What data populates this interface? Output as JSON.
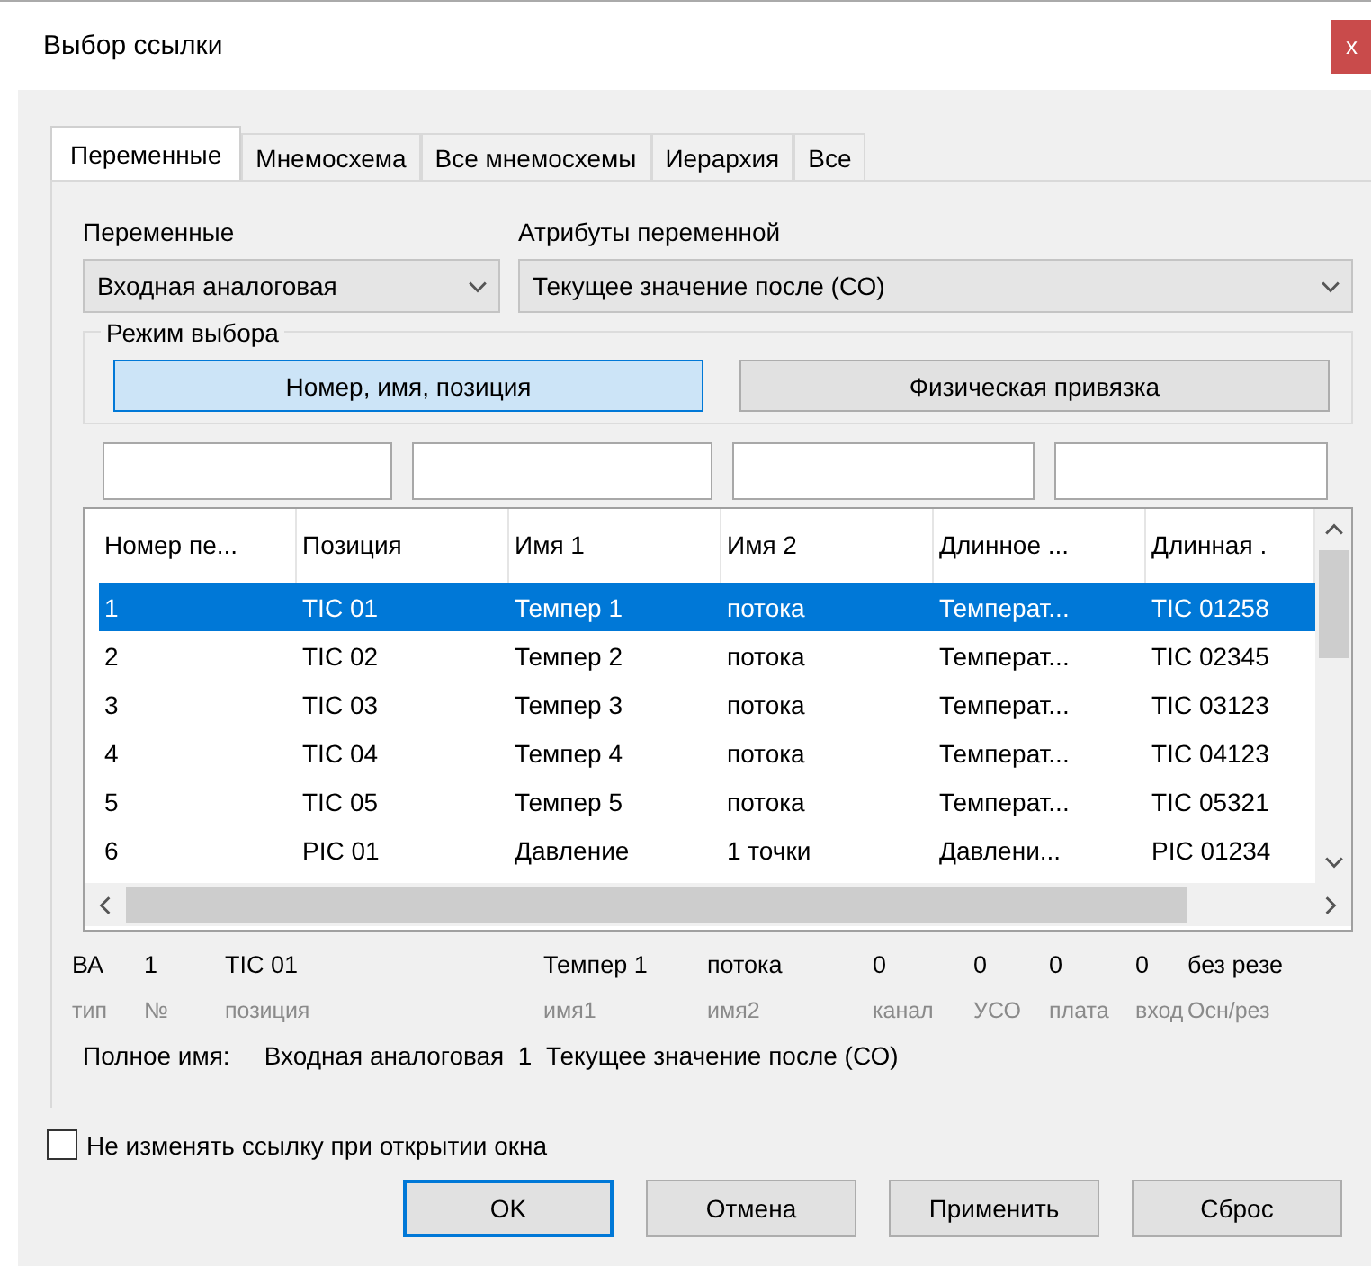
{
  "window": {
    "title": "Выбор ссылки",
    "close": "x"
  },
  "tabs": [
    {
      "label": "Переменные",
      "selected": true
    },
    {
      "label": "Мнемосхема",
      "selected": false
    },
    {
      "label": "Все мнемосхемы",
      "selected": false
    },
    {
      "label": "Иерархия",
      "selected": false
    },
    {
      "label": "Все",
      "selected": false
    }
  ],
  "variables": {
    "label": "Переменные",
    "value": "Входная аналоговая"
  },
  "attributes": {
    "label": "Атрибуты переменной",
    "value": "Текущее значение после (СО)"
  },
  "selection_mode": {
    "title": "Режим выбора",
    "buttons": [
      {
        "label": "Номер, имя, позиция",
        "selected": true
      },
      {
        "label": "Физическая привязка",
        "selected": false
      }
    ]
  },
  "table": {
    "columns": [
      "Номер пе...",
      "Позиция",
      "Имя 1",
      "Имя 2",
      "Длинное ...",
      "Длинная ."
    ],
    "rows": [
      {
        "cells": [
          "1",
          "TIC 01",
          "Темпер 1",
          "потока",
          "Температ...",
          "TIC 01258"
        ],
        "selected": true
      },
      {
        "cells": [
          "2",
          "TIC 02",
          "Темпер 2",
          "потока",
          "Температ...",
          "TIC 02345"
        ],
        "selected": false
      },
      {
        "cells": [
          "3",
          "TIC 03",
          "Темпер 3",
          "потока",
          "Температ...",
          "TIC 03123"
        ],
        "selected": false
      },
      {
        "cells": [
          "4",
          "TIC 04",
          "Темпер 4",
          "потока",
          "Температ...",
          "TIC 04123"
        ],
        "selected": false
      },
      {
        "cells": [
          "5",
          "TIC 05",
          "Темпер 5",
          "потока",
          "Температ...",
          "TIC 05321"
        ],
        "selected": false
      },
      {
        "cells": [
          "6",
          "PIC 01",
          "Давление",
          "1 точки",
          "Давлени...",
          "PIC 01234"
        ],
        "selected": false
      }
    ]
  },
  "details": {
    "values": [
      "ВА",
      "1",
      "TIC 01",
      "Темпер 1",
      "потока",
      "0",
      "0",
      "0",
      "0",
      "без резе"
    ],
    "labels": [
      "тип",
      "№",
      "позиция",
      "имя1",
      "имя2",
      "канал",
      "УСО",
      "плата",
      "вход",
      "Осн/рез"
    ]
  },
  "full_name": {
    "label": "Полное имя:",
    "value": "Входная аналоговая  1  Текущее значение после (СО)"
  },
  "keep_link": {
    "label": "Не изменять ссылку при открытии окна",
    "checked": false
  },
  "buttons": [
    {
      "label": "OK",
      "default": true
    },
    {
      "label": "Отмена",
      "default": false
    },
    {
      "label": "Применить",
      "default": false
    },
    {
      "label": "Сброс",
      "default": false
    }
  ]
}
